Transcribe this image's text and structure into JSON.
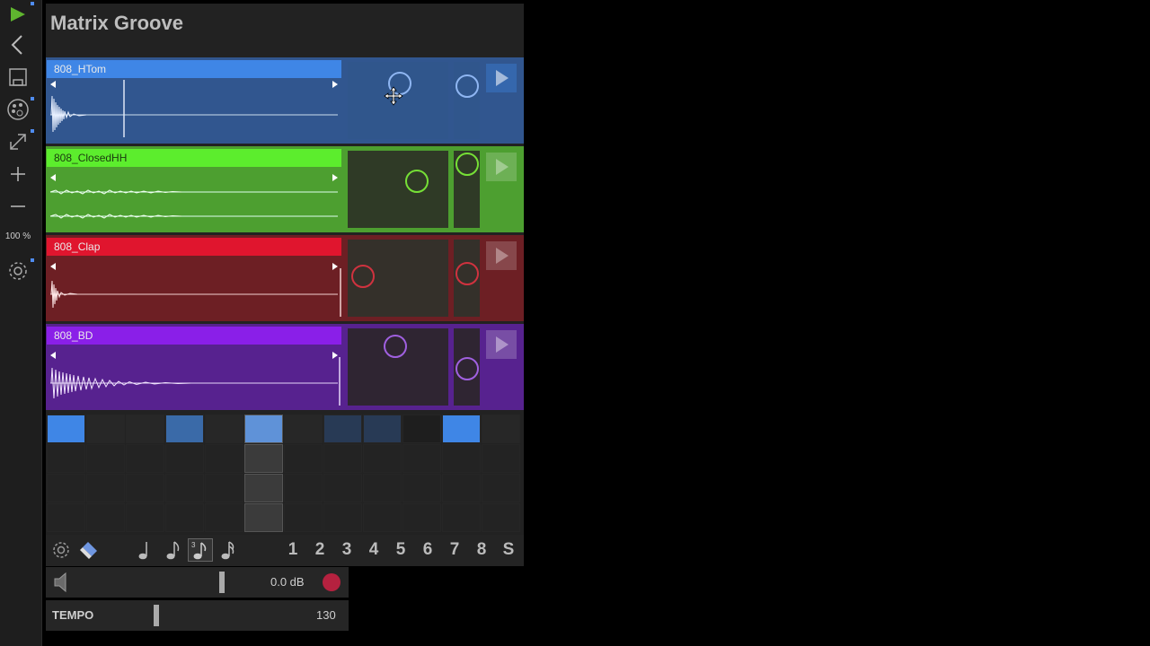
{
  "app": {
    "title": "Matrix Groove"
  },
  "toolbar": {
    "zoom": "100 %",
    "items": [
      "play-icon",
      "back-icon",
      "save-icon",
      "palette-icon",
      "resize-icon",
      "plus-icon",
      "minus-icon",
      "settings-icon"
    ]
  },
  "tracks": [
    {
      "name": "808_HTom",
      "bar_color": "#3f86e6",
      "bg_color": "#31568f",
      "pad_color": "#30568c",
      "knob_color": "#8fb6f2"
    },
    {
      "name": "808_ClosedHH",
      "bar_color": "#5ced2d",
      "bg_color": "#4d9f30",
      "pad_color": "#2f3a26",
      "knob_color": "#76e036"
    },
    {
      "name": "808_Clap",
      "bar_color": "#e0152e",
      "bg_color": "#6d1f24",
      "pad_color": "#34302a",
      "knob_color": "#d0323f"
    },
    {
      "name": "808_BD",
      "bar_color": "#8a1fe8",
      "bg_color": "#57228f",
      "pad_color": "#2f2532",
      "knob_color": "#a060e0"
    }
  ],
  "step_grid": {
    "columns": 12,
    "active_steps": [
      0,
      3,
      5,
      10
    ],
    "dim_steps": [
      7,
      8
    ],
    "cursor_column": 5,
    "active_color": "#3f86e6"
  },
  "bottom_bar": {
    "icons": [
      "gear-icon",
      "eraser-icon",
      "quarter-note-icon",
      "eighth-note-icon",
      "triplet-note-icon",
      "sixteenth-note-icon"
    ],
    "numbers": [
      "1",
      "2",
      "3",
      "4",
      "5",
      "6",
      "7",
      "8",
      "S"
    ]
  },
  "volume": {
    "value": "0.0 dB",
    "record_color": "#b5213f"
  },
  "tempo": {
    "label": "TEMPO",
    "value": "130"
  }
}
